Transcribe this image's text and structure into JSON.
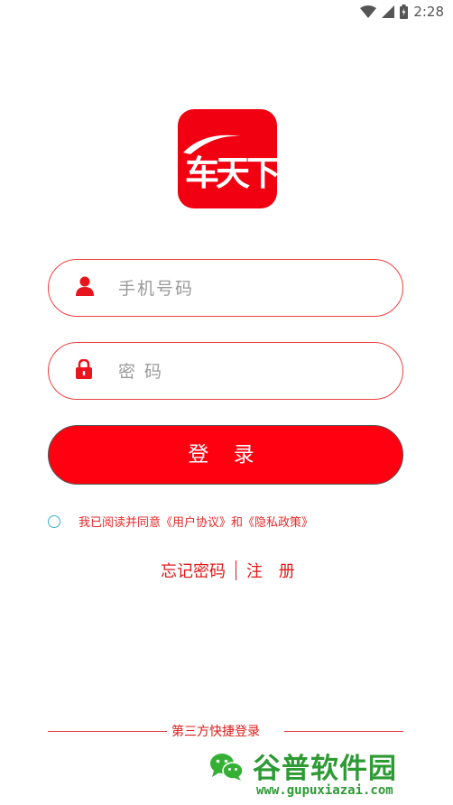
{
  "status_bar": {
    "time": "2:28"
  },
  "logo": {
    "text": "车天下",
    "brand_color": "#f00010"
  },
  "login_form": {
    "phone_placeholder": "手机号码",
    "password_placeholder": "密 码",
    "login_label": "登 录"
  },
  "agreement": {
    "text": "我已阅读并同意《用户协议》和《隐私政策》"
  },
  "links": {
    "forgot": "忘记密码",
    "register": "注 册"
  },
  "third_party": {
    "title": "第三方快捷登录"
  },
  "watermark": {
    "title": "谷普软件园",
    "url": "www.gupuxiazai.com"
  },
  "colors": {
    "accent": "#ff0010",
    "text_red": "#e01818"
  }
}
